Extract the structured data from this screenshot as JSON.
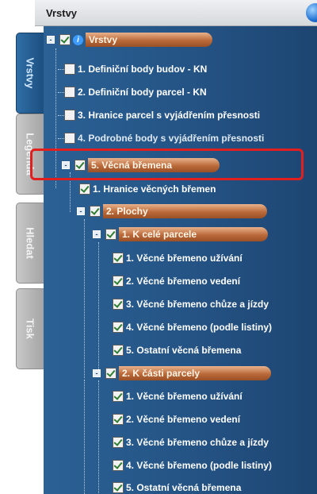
{
  "header": {
    "title": "Vrstvy",
    "icon": "globe-icon"
  },
  "tabs": [
    {
      "label": "Vrstvy",
      "active": true
    },
    {
      "label": "Legenda",
      "active": false
    },
    {
      "label": "Hledat",
      "active": false
    },
    {
      "label": "Tisk",
      "active": false
    }
  ],
  "tree": {
    "root": {
      "label": "Vrstvy",
      "icon": "info-icon"
    },
    "layers": [
      {
        "label": "1. Definiční body budov - KN",
        "checked": false
      },
      {
        "label": "2. Definiční body parcel - KN",
        "checked": false
      },
      {
        "label": "3. Hranice parcel s vyjádřením přesnosti",
        "checked": false
      },
      {
        "label": "4. Podrobné body s vyjádřením přesnosti",
        "checked": false
      }
    ],
    "group5": {
      "label": "5. Věcná břemena",
      "hranice": "1. Hranice věcných břemen",
      "plochy": {
        "label": "2. Plochy",
        "cele": {
          "label": "1. K celé parcele",
          "items": [
            "1. Věcné břemeno užívání",
            "2. Věcné břemeno vedení",
            "3. Věcné břemeno chůze a jízdy",
            "4. Věcné břemeno (podle listiny)",
            "5. Ostatní věcná břemena"
          ]
        },
        "casti": {
          "label": "2. K části parcely",
          "items": [
            "1. Věcné břemeno užívání",
            "2. Věcné břemeno vedení",
            "3. Věcné břemeno chůze a jízdy",
            "4. Věcné břemeno (podle listiny)",
            "5. Ostatní věcná břemena"
          ]
        }
      }
    }
  },
  "highlight_color": "#e21f1f"
}
